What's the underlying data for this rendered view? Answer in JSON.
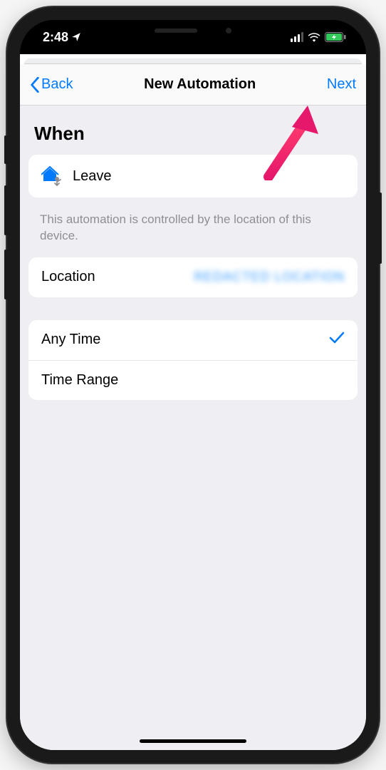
{
  "status_bar": {
    "time": "2:48",
    "has_location_arrow": true
  },
  "nav": {
    "back_label": "Back",
    "title": "New Automation",
    "next_label": "Next"
  },
  "content": {
    "section_header": "When",
    "trigger": {
      "label": "Leave"
    },
    "footer_note": "This automation is controlled by the location of this device.",
    "location": {
      "label": "Location",
      "value": "REDACTED LOCATION"
    },
    "time_options": {
      "any_time": "Any Time",
      "time_range": "Time Range",
      "selected": "any_time"
    }
  },
  "annotation": {
    "arrow_color": "#e6186b"
  }
}
